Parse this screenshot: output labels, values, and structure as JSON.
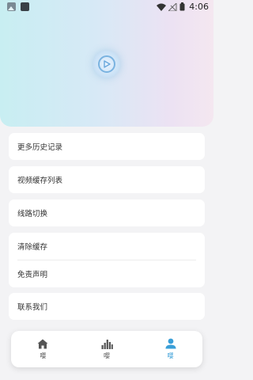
{
  "status_bar": {
    "time": "4:06"
  },
  "menu": {
    "history": "更多历史记录",
    "cache_list": "视频缓存列表",
    "route_switch": "线路切换",
    "clear_cache": "清除缓存",
    "disclaimer": "免责声明",
    "contact": "联系我们"
  },
  "bottom_nav": {
    "home": "嘤",
    "stats": "嘤",
    "profile": "嘤"
  },
  "colors": {
    "accent": "#3a9fd8"
  }
}
